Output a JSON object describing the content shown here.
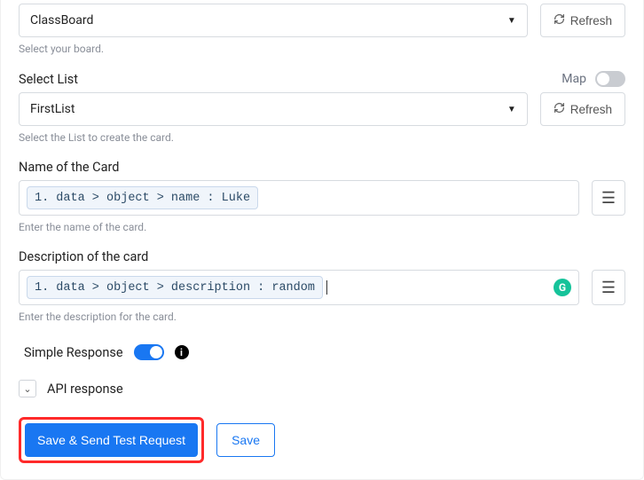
{
  "board": {
    "value": "ClassBoard",
    "refresh_label": "Refresh",
    "helper": "Select your board."
  },
  "list": {
    "label": "Select List",
    "map_label": "Map",
    "map_on": false,
    "value": "FirstList",
    "refresh_label": "Refresh",
    "helper": "Select the List to create the card."
  },
  "name_field": {
    "label": "Name of the Card",
    "chip": "1. data > object > name : Luke",
    "helper": "Enter the name of the card."
  },
  "desc_field": {
    "label": "Description of the card",
    "chip": "1. data > object > description : random",
    "helper": "Enter the description for the card."
  },
  "simple_response": {
    "label": "Simple Response",
    "on": true
  },
  "api_response": {
    "label": "API response"
  },
  "actions": {
    "primary": "Save & Send Test Request",
    "secondary": "Save"
  }
}
